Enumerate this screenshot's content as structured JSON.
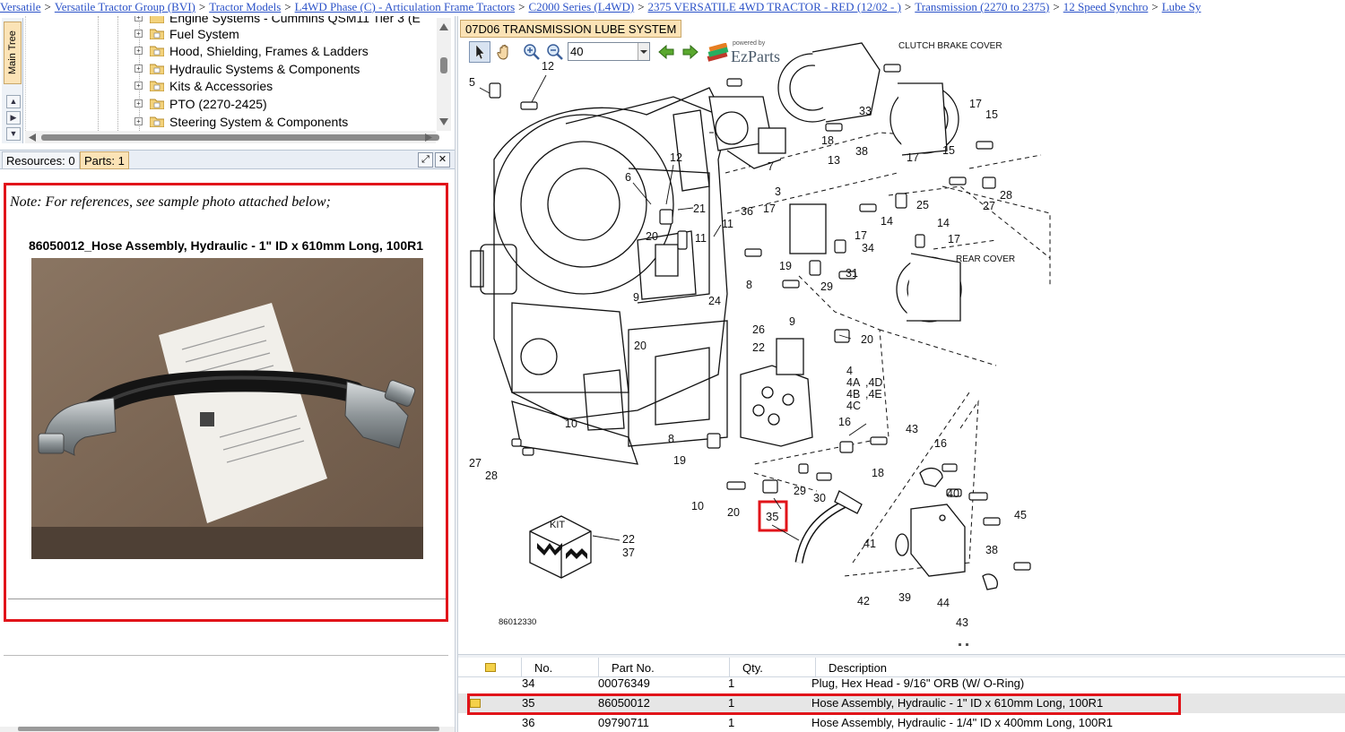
{
  "breadcrumb": [
    "Versatile",
    "Versatile Tractor Group (BVI)",
    "Tractor Models",
    "L4WD Phase (C) - Articulation Frame Tractors",
    "C2000 Series (L4WD)",
    "2375 VERSATILE 4WD TRACTOR - RED (12/02 - )",
    "Transmission (2270 to 2375)",
    "12 Speed Synchro",
    "Lube Sy"
  ],
  "breadcrumb_separator": ">",
  "side_tab": {
    "label": "Main Tree"
  },
  "tree": {
    "items": [
      {
        "label": "Engine Systems - Cummins QSM11 Tier 3 (E"
      },
      {
        "label": "Fuel System"
      },
      {
        "label": "Hood, Shielding, Frames & Ladders"
      },
      {
        "label": "Hydraulic Systems & Components"
      },
      {
        "label": "Kits & Accessories"
      },
      {
        "label": "PTO (2270-2425)"
      },
      {
        "label": "Steering System & Components"
      }
    ]
  },
  "panel_tabs": {
    "resources": "Resources: 0",
    "parts": "Parts: 1"
  },
  "note": {
    "text": "Note: For references, see sample photo attached below;",
    "photo_caption": "86050012_Hose Assembly, Hydraulic - 1\" ID x 610mm Long, 100R1"
  },
  "diagram": {
    "tab_label": "07D06 TRANSMISSION LUBE SYSTEM",
    "zoom_value": "40",
    "brand_small": "powered by",
    "brand": "EzParts",
    "drawing_number": "86012330",
    "callouts": {
      "clutch_brake_cover": "CLUTCH BRAKE COVER",
      "rear_cover": "REAR COVER",
      "kit": "KIT"
    },
    "highlighted_callout": "35"
  },
  "parts_table": {
    "columns": [
      "No.",
      "Part No.",
      "Qty.",
      "Description"
    ],
    "rows": [
      {
        "no": "34",
        "part_no": "00076349",
        "qty": "1",
        "description": "Plug, Hex Head - 9/16\" ORB (W/ O-Ring)",
        "selected": false
      },
      {
        "no": "35",
        "part_no": "86050012",
        "qty": "1",
        "description": "Hose Assembly, Hydraulic - 1\" ID x 610mm Long, 100R1",
        "selected": true
      },
      {
        "no": "36",
        "part_no": "09790711",
        "qty": "1",
        "description": "Hose Assembly, Hydraulic - 1/4\" ID x 400mm Long, 100R1",
        "selected": false
      }
    ]
  },
  "colors": {
    "link": "#2b52c8",
    "highlight": "#e1141a",
    "active_tab": "#fbe3b6"
  }
}
